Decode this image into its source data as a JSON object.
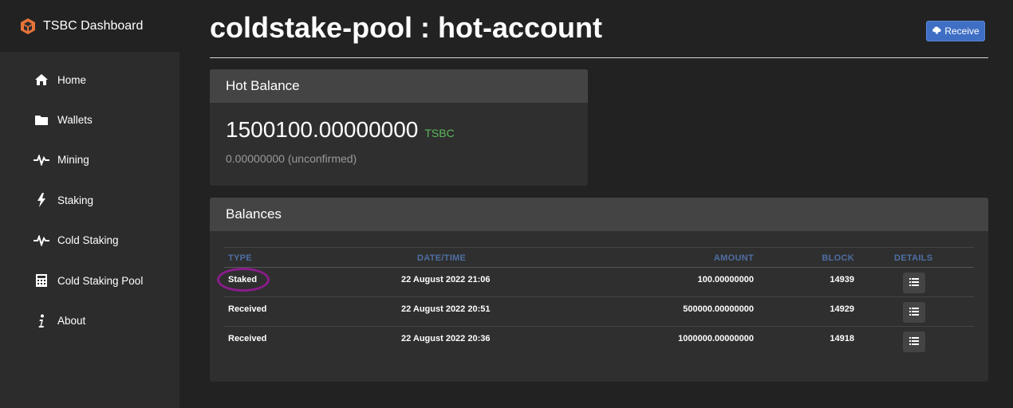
{
  "brand": {
    "title": "TSBC Dashboard"
  },
  "sidebar": {
    "items": [
      {
        "label": "Home",
        "icon": "home-icon"
      },
      {
        "label": "Wallets",
        "icon": "folder-icon"
      },
      {
        "label": "Mining",
        "icon": "pulse-icon"
      },
      {
        "label": "Staking",
        "icon": "lightning-icon"
      },
      {
        "label": "Cold Staking",
        "icon": "pulse-icon"
      },
      {
        "label": "Cold Staking Pool",
        "icon": "calculator-icon"
      },
      {
        "label": "About",
        "icon": "info-icon"
      }
    ]
  },
  "page": {
    "title": "coldstake-pool : hot-account",
    "receive_label": "Receive"
  },
  "hot_balance": {
    "header": "Hot Balance",
    "amount": "1500100.00000000",
    "unit": "TSBC",
    "unconfirmed": "0.00000000 (unconfirmed)"
  },
  "balances": {
    "header": "Balances",
    "columns": [
      "TYPE",
      "DATE/TIME",
      "AMOUNT",
      "BLOCK",
      "DETAILS"
    ],
    "rows": [
      {
        "type": "Staked",
        "datetime": "22 August 2022 21:06",
        "amount": "100.00000000",
        "block": "14939"
      },
      {
        "type": "Received",
        "datetime": "22 August 2022 20:51",
        "amount": "500000.00000000",
        "block": "14929"
      },
      {
        "type": "Received",
        "datetime": "22 August 2022 20:36",
        "amount": "1000000.00000000",
        "block": "14918"
      }
    ]
  },
  "colors": {
    "accent": "#3f6fc4",
    "unit_green": "#5cb85c",
    "header_blue": "#4e6fa3",
    "highlight": "#8a1c8a"
  }
}
